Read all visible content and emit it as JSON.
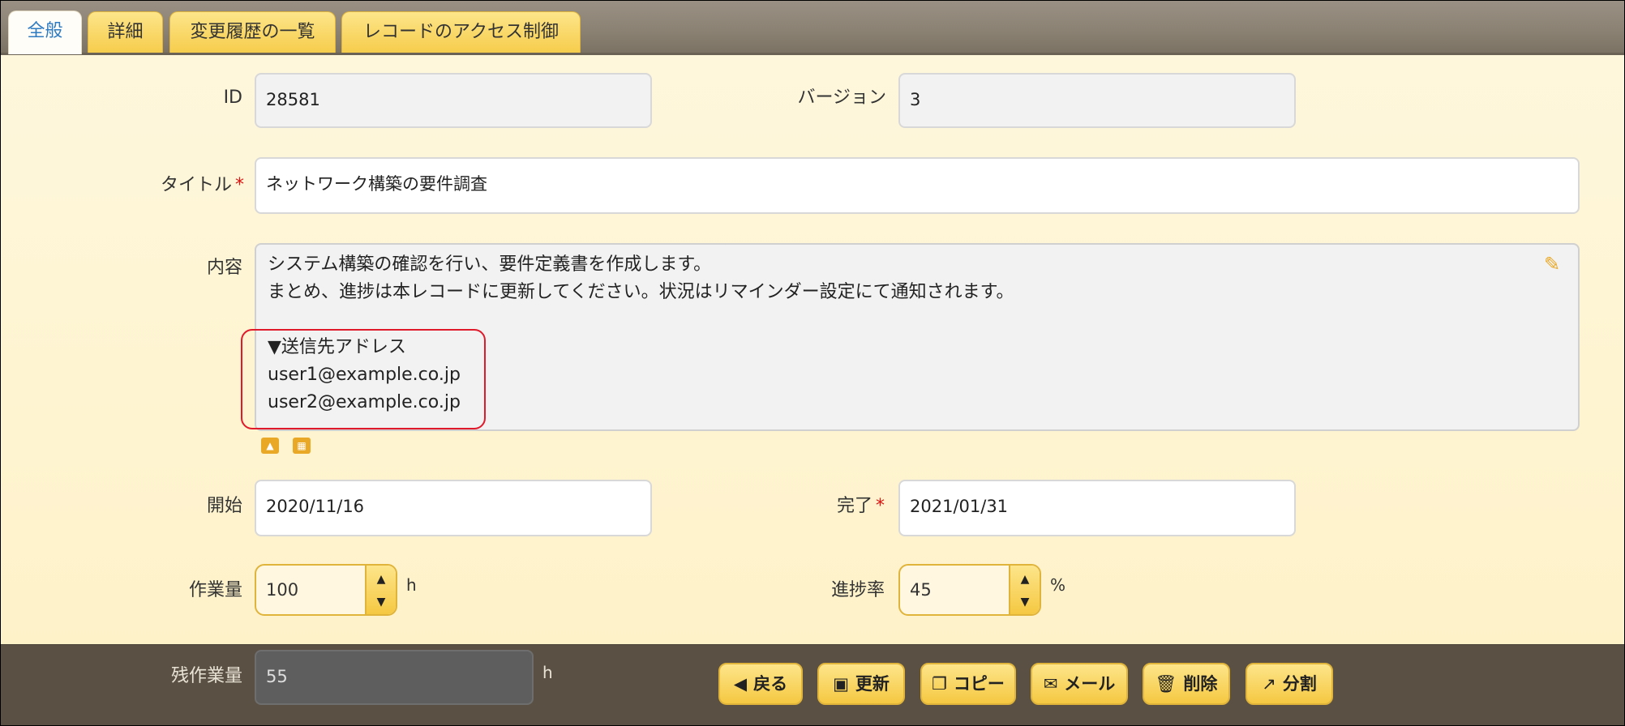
{
  "tabs": [
    {
      "label": "全般",
      "active": true
    },
    {
      "label": "詳細",
      "active": false
    },
    {
      "label": "変更履歴の一覧",
      "active": false
    },
    {
      "label": "レコードのアクセス制御",
      "active": false
    }
  ],
  "form": {
    "id_label": "ID",
    "id_value": "28581",
    "version_label": "バージョン",
    "version_value": "3",
    "title_label": "タイトル",
    "required_mark": "*",
    "title_value": "ネットワーク構築の要件調査",
    "body_label": "内容",
    "body_lines": [
      "システム構築の確認を行い、要件定義書を作成します。",
      "まとめ、進捗は本レコードに更新してください。状況はリマインダー設定にて通知されます。",
      "",
      "▼送信先アドレス",
      "user1@example.co.jp",
      "user2@example.co.jp"
    ],
    "start_label": "開始",
    "start_value": "2020/11/16",
    "end_label": "完了",
    "end_value": "2021/01/31",
    "work_label": "作業量",
    "work_value": "100",
    "work_unit": "h",
    "progress_label": "進捗率",
    "progress_value": "45",
    "progress_unit": "%",
    "remaining_label": "残作業量",
    "remaining_value": "55",
    "remaining_unit": "h"
  },
  "buttons": {
    "back": "戻る",
    "update": "更新",
    "copy": "コピー",
    "mail": "メール",
    "delete": "削除",
    "split": "分割"
  },
  "icons": {
    "edit": "pencil-icon",
    "image": "image-icon",
    "table": "table-icon"
  },
  "colors": {
    "accent": "#f5c842",
    "active_tab_text": "#2f7bc2",
    "highlight_box": "#e0192b",
    "required": "#dd1111"
  }
}
